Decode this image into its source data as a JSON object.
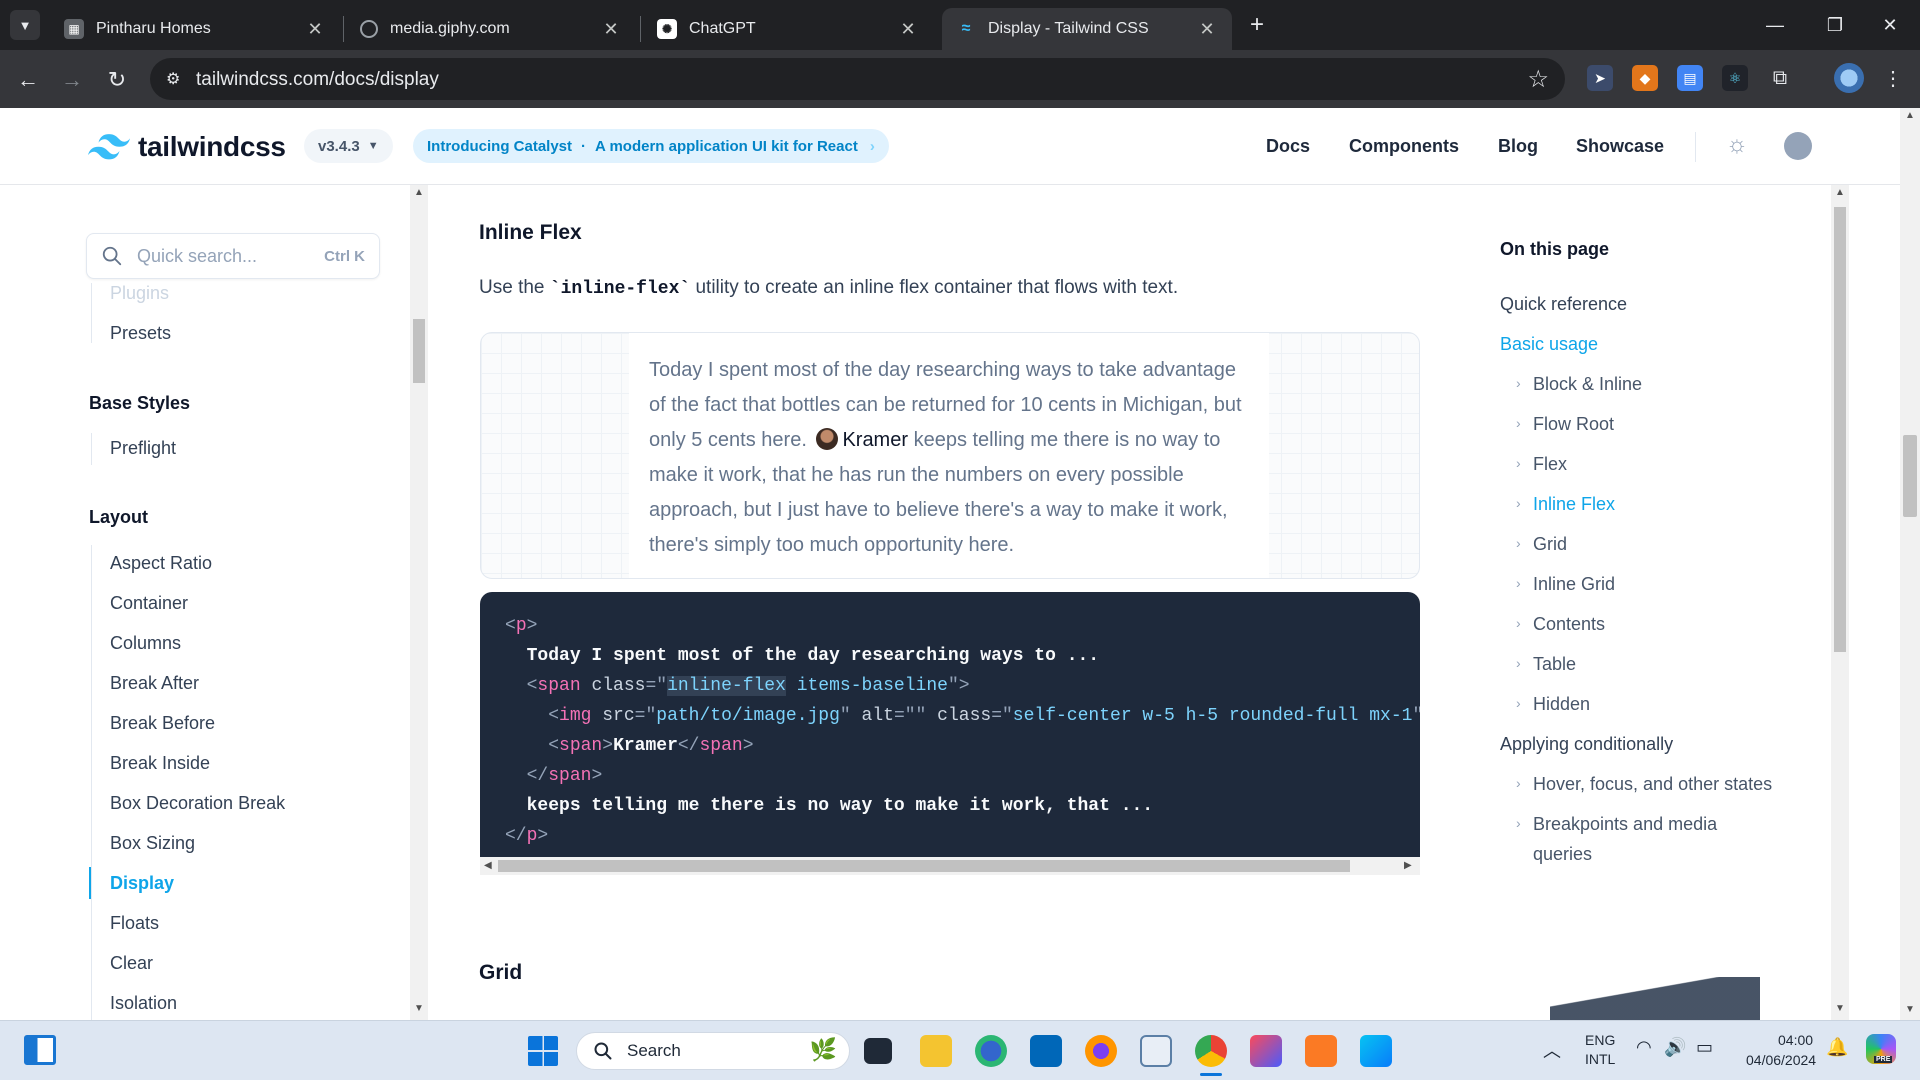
{
  "browser": {
    "tabs": [
      {
        "title": "Pintharu Homes",
        "icon": "chart-icon",
        "active": false
      },
      {
        "title": "media.giphy.com",
        "icon": "globe-icon",
        "active": false
      },
      {
        "title": "ChatGPT",
        "icon": "openai-icon",
        "active": false
      },
      {
        "title": "Display - Tailwind CSS",
        "icon": "tailwind-icon",
        "active": true
      }
    ],
    "url": "tailwindcss.com/docs/display",
    "new_tab": "+"
  },
  "site": {
    "logo_text": "tailwindcss",
    "version": "v3.4.3",
    "promo": "Introducing Catalyst",
    "promo_sep": "·",
    "promo_sub": "A modern application UI kit for React",
    "nav": [
      "Docs",
      "Components",
      "Blog",
      "Showcase"
    ],
    "brand_color": "#38bdf8",
    "accent_color": "#0ea5e9"
  },
  "sidebar": {
    "search_placeholder": "Quick search...",
    "search_shortcut": "Ctrl K",
    "partial_item": "Plugins",
    "items_top": [
      "Presets"
    ],
    "section_base": "Base Styles",
    "base_items": [
      "Preflight"
    ],
    "section_layout": "Layout",
    "layout_items": [
      "Aspect Ratio",
      "Container",
      "Columns",
      "Break After",
      "Break Before",
      "Break Inside",
      "Box Decoration Break",
      "Box Sizing",
      "Display",
      "Floats",
      "Clear",
      "Isolation"
    ],
    "active_item": "Display"
  },
  "main": {
    "heading": "Inline Flex",
    "desc_before": "Use the ",
    "desc_code": "`inline-flex`",
    "desc_after": " utility to create an inline flex container that flows with text.",
    "preview_text_1": "Today I spent most of the day researching ways to take advantage of the fact that bottles can be returned for 10 cents in Michigan, but only 5 cents here.",
    "preview_name": "Kramer",
    "preview_text_2": " keeps telling me there is no way to make it work, that he has run the numbers on every possible approach, but I just have to believe there's a way to make it work, there's simply too much opportunity here.",
    "code": {
      "l1_open": "<",
      "l1_tag": "p",
      "l1_close": ">",
      "l2": "Today I spent most of the day researching ways to ...",
      "l3_tag": "span",
      "l3_attr": "class",
      "l3_val_hl": "inline-flex",
      "l3_val_rest": " items-baseline",
      "l4_tag": "img",
      "l4_src": "path/to/image.jpg",
      "l4_alt": "",
      "l4_class": "self-center w-5 h-5 rounded-full mx-1",
      "l5_tag": "span",
      "l5_text": "Kramer",
      "l6_tag": "span",
      "l7": "keeps telling me there is no way to make it work, that ...",
      "l8_tag": "p"
    },
    "next_heading": "Grid"
  },
  "toc": {
    "title": "On this page",
    "items": [
      {
        "label": "Quick reference",
        "level": 1
      },
      {
        "label": "Basic usage",
        "level": 1,
        "active": true
      },
      {
        "label": "Block & Inline",
        "level": 2
      },
      {
        "label": "Flow Root",
        "level": 2
      },
      {
        "label": "Flex",
        "level": 2
      },
      {
        "label": "Inline Flex",
        "level": 2,
        "active": true
      },
      {
        "label": "Grid",
        "level": 2
      },
      {
        "label": "Inline Grid",
        "level": 2
      },
      {
        "label": "Contents",
        "level": 2
      },
      {
        "label": "Table",
        "level": 2
      },
      {
        "label": "Hidden",
        "level": 2
      },
      {
        "label": "Applying conditionally",
        "level": 1
      },
      {
        "label": "Hover, focus, and other states",
        "level": 2
      },
      {
        "label": "Breakpoints and media",
        "level": 2
      },
      {
        "label": "queries",
        "level": 3
      }
    ]
  },
  "taskbar": {
    "search": "Search",
    "lang1": "ENG",
    "lang2": "INTL",
    "time": "04:00",
    "date": "04/06/2024",
    "pre_badge": "PRE"
  }
}
